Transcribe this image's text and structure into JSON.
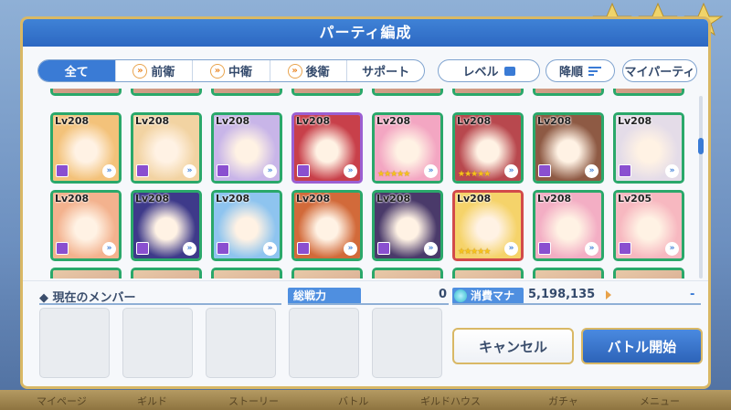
{
  "bottom_nav": [
    "マイページ",
    "ギルド",
    "ストーリー",
    "バトル",
    "ギルドハウス",
    "ガチャ",
    "メニュー"
  ],
  "dialog": {
    "title": "パーティ編成",
    "tabs": [
      {
        "label": "全て",
        "active": true
      },
      {
        "label": "前衛",
        "active": false
      },
      {
        "label": "中衛",
        "active": false
      },
      {
        "label": "後衛",
        "active": false
      },
      {
        "label": "サポート",
        "active": false
      }
    ],
    "sort_level_label": "レベル",
    "sort_order_label": "降順",
    "my_party_label": "マイパーティ",
    "characters_row1": [
      {
        "level": "Lv208",
        "frame": "green",
        "stars": "",
        "portrait": "#f3c27a"
      },
      {
        "level": "Lv208",
        "frame": "green",
        "stars": "",
        "portrait": "#f2d3a2"
      },
      {
        "level": "Lv208",
        "frame": "green",
        "stars": "",
        "portrait": "#c8b5e8"
      },
      {
        "level": "Lv208",
        "frame": "purple",
        "stars": "",
        "portrait": "#c8404a"
      },
      {
        "level": "Lv208",
        "frame": "green",
        "stars": "★★★★★",
        "portrait": "#f3a6c2"
      },
      {
        "level": "Lv208",
        "frame": "green",
        "stars": "★★★★★",
        "portrait": "#b8484e"
      },
      {
        "level": "Lv208",
        "frame": "green",
        "stars": "",
        "portrait": "#8e5a44"
      },
      {
        "level": "Lv208",
        "frame": "green",
        "stars": "",
        "portrait": "#e4dce8"
      }
    ],
    "characters_row2": [
      {
        "level": "Lv208",
        "frame": "green",
        "stars": "",
        "portrait": "#f3b28e"
      },
      {
        "level": "Lv208",
        "frame": "green",
        "stars": "",
        "portrait": "#3e3a8a"
      },
      {
        "level": "Lv208",
        "frame": "green",
        "stars": "",
        "portrait": "#8ec4ef"
      },
      {
        "level": "Lv208",
        "frame": "green",
        "stars": "",
        "portrait": "#d26a3a"
      },
      {
        "level": "Lv208",
        "frame": "green",
        "stars": "",
        "portrait": "#4a3a6a"
      },
      {
        "level": "Lv208",
        "frame": "red",
        "stars": "★★★★★",
        "portrait": "#f5d36a"
      },
      {
        "level": "Lv208",
        "frame": "green",
        "stars": "",
        "portrait": "#f3aec4"
      },
      {
        "level": "Lv205",
        "frame": "green",
        "stars": "",
        "portrait": "#f7b8c0"
      }
    ],
    "current_members_label": "現在のメンバー",
    "total_power_label": "総戦力",
    "total_power_value": "0",
    "mana_label": "消費マナ",
    "mana_value": "5,198,135",
    "mana_extra": "-",
    "cancel_label": "キャンセル",
    "start_label": "バトル開始"
  }
}
